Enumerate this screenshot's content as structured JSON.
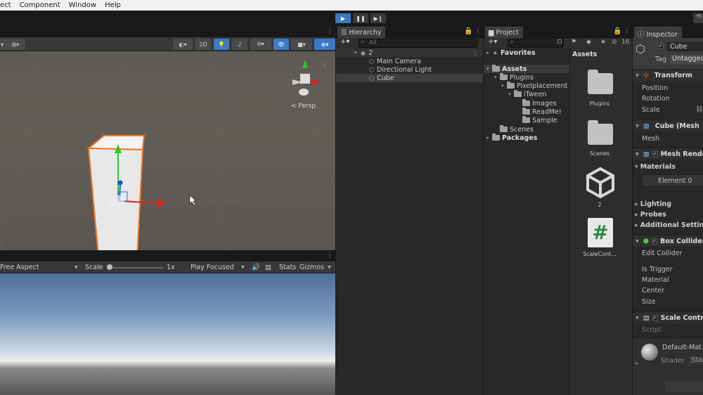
{
  "menu": [
    "ect",
    "Component",
    "Window",
    "Help"
  ],
  "playbar": {
    "play": "▶",
    "pause": "❚❚",
    "step": "▶❙"
  },
  "scene_toolbar": {
    "mode_2d": "2D"
  },
  "scene": {
    "persp_label": "< Persp"
  },
  "game_toolbar": {
    "aspect": "Free Aspect",
    "scale_label": "Scale",
    "scale_value": "1x",
    "play_mode": "Play Focused",
    "stats": "Stats",
    "gizmos": "Gizmos"
  },
  "hierarchy": {
    "tab": "Hierarchy",
    "search_placeholder": "All",
    "scene_name": "2",
    "items": [
      "Main Camera",
      "Directional Light",
      "Cube"
    ]
  },
  "project": {
    "tab": "Project",
    "hidden_count": "16",
    "tree": {
      "favorites": "Favorites",
      "assets": "Assets",
      "plugins": "Plugins",
      "pixelplacement": "Pixelplacement",
      "itween": "iTween",
      "images": "Images",
      "readme": "ReadMe!",
      "sample": "Sample",
      "scenes": "Scenes",
      "packages": "Packages"
    },
    "assets_header": "Assets",
    "assets": [
      "Plugins",
      "Scenes",
      "2",
      "ScaleCont..."
    ]
  },
  "inspector": {
    "tab": "Inspector",
    "object_name": "Cube",
    "tag_label": "Tag",
    "tag_value": "Untagged",
    "transform": {
      "title": "Transform",
      "position": "Position",
      "rotation": "Rotation",
      "scale": "Scale"
    },
    "mesh_filter": {
      "title": "Cube (Mesh",
      "mesh": "Mesh"
    },
    "mesh_renderer": {
      "title": "Mesh Rende",
      "materials": "Materials",
      "element0": "Element 0",
      "lighting": "Lighting",
      "probes": "Probes",
      "additional": "Additional Setting"
    },
    "box_collider": {
      "title": "Box Collider",
      "edit": "Edit Collider",
      "is_trigger": "Is Trigger",
      "material": "Material",
      "center": "Center",
      "size": "Size"
    },
    "scale_control": {
      "title": "Scale Contr",
      "script": "Script"
    },
    "material": {
      "name": "Default-Mat",
      "shader_label": "Shader",
      "shader_value": "Stan"
    }
  },
  "colors": {
    "accent": "#3a78c4",
    "selection_outline": "#f07820",
    "panel_bg": "#282828"
  }
}
